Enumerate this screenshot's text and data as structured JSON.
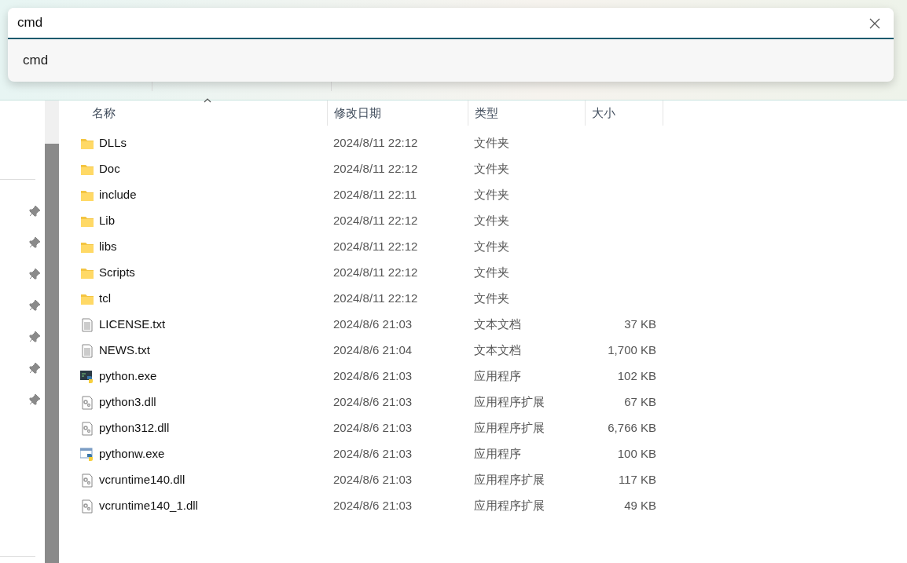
{
  "search": {
    "value": "cmd",
    "suggestions": [
      "cmd"
    ]
  },
  "columns": [
    "名称",
    "修改日期",
    "类型",
    "大小"
  ],
  "rows": [
    {
      "kind": "folder",
      "name": "DLLs",
      "modified": "2024/8/11 22:12",
      "type": "文件夹"
    },
    {
      "kind": "folder",
      "name": "Doc",
      "modified": "2024/8/11 22:12",
      "type": "文件夹"
    },
    {
      "kind": "folder",
      "name": "include",
      "modified": "2024/8/11 22:11",
      "type": "文件夹"
    },
    {
      "kind": "folder",
      "name": "Lib",
      "modified": "2024/8/11 22:12",
      "type": "文件夹"
    },
    {
      "kind": "folder",
      "name": "libs",
      "modified": "2024/8/11 22:12",
      "type": "文件夹"
    },
    {
      "kind": "folder",
      "name": "Scripts",
      "modified": "2024/8/11 22:12",
      "type": "文件夹"
    },
    {
      "kind": "folder",
      "name": "tcl",
      "modified": "2024/8/11 22:12",
      "type": "文件夹"
    },
    {
      "kind": "text",
      "name": "LICENSE.txt",
      "modified": "2024/8/6 21:03",
      "type": "文本文档",
      "size": "37 KB"
    },
    {
      "kind": "text",
      "name": "NEWS.txt",
      "modified": "2024/8/6 21:04",
      "type": "文本文档",
      "size": "1,700 KB"
    },
    {
      "kind": "console-exe",
      "name": "python.exe",
      "modified": "2024/8/6 21:03",
      "type": "应用程序",
      "size": "102 KB"
    },
    {
      "kind": "dll",
      "name": "python3.dll",
      "modified": "2024/8/6 21:03",
      "type": "应用程序扩展",
      "size": "67 KB"
    },
    {
      "kind": "dll",
      "name": "python312.dll",
      "modified": "2024/8/6 21:03",
      "type": "应用程序扩展",
      "size": "6,766 KB"
    },
    {
      "kind": "window-exe",
      "name": "pythonw.exe",
      "modified": "2024/8/6 21:03",
      "type": "应用程序",
      "size": "100 KB"
    },
    {
      "kind": "dll",
      "name": "vcruntime140.dll",
      "modified": "2024/8/6 21:03",
      "type": "应用程序扩展",
      "size": "117 KB"
    },
    {
      "kind": "dll",
      "name": "vcruntime140_1.dll",
      "modified": "2024/8/6 21:03",
      "type": "应用程序扩展",
      "size": "49 KB"
    }
  ]
}
